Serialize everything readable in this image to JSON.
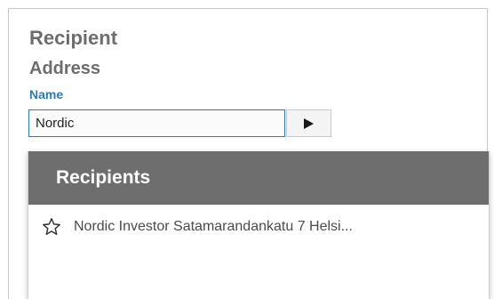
{
  "form": {
    "title": "Recipient",
    "subtitle": "Address",
    "name_label": "Name",
    "name_value": "Nordic"
  },
  "dropdown": {
    "title": "Recipients",
    "items": [
      {
        "label": "Nordic Investor Satamarandankatu 7 Helsi..."
      }
    ]
  },
  "colors": {
    "label_blue": "#2d7ab5",
    "heading_gray": "#6d6d6d",
    "header_bg": "#6e6e6e"
  },
  "icons": {
    "submit": "play-icon",
    "favorite": "star-icon"
  }
}
